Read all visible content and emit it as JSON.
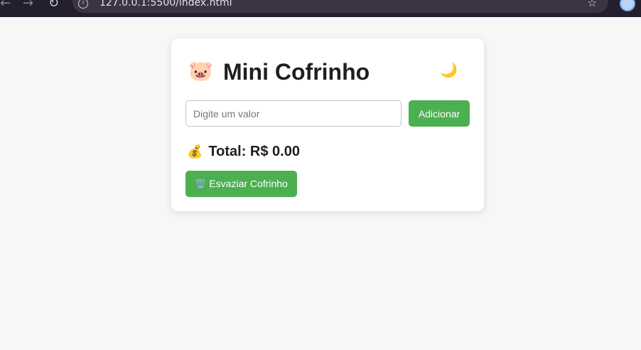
{
  "browser": {
    "url": "127.0.0.1:5500/index.html"
  },
  "app": {
    "title": "Mini Cofrinho",
    "title_icon": "🐷",
    "theme_toggle_icon": "🌙"
  },
  "form": {
    "value_placeholder": "Digite um valor",
    "value": "",
    "add_label": "Adicionar"
  },
  "total": {
    "icon": "💰",
    "label": "Total: R$ 0.00"
  },
  "actions": {
    "empty_icon": "🗑️",
    "empty_label": "Esvaziar Cofrinho"
  },
  "colors": {
    "accent": "#4caf50",
    "background": "#f7f7f7",
    "card": "#ffffff"
  }
}
